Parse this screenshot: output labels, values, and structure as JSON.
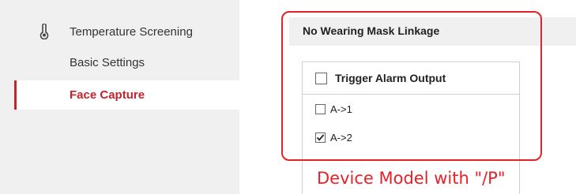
{
  "sidebar": {
    "section_label": "Temperature Screening",
    "section_icon": "thermometer-icon",
    "items": [
      {
        "label": "Basic Settings",
        "active": false
      },
      {
        "label": "Face Capture",
        "active": true
      }
    ],
    "accent_color": "#c4232b"
  },
  "panel": {
    "title": "No Wearing Mask Linkage",
    "table": {
      "header_label": "Trigger Alarm Output",
      "header_checked": false,
      "rows": [
        {
          "label": "A->1",
          "checked": false
        },
        {
          "label": "A->2",
          "checked": true
        }
      ]
    }
  },
  "annotation": {
    "caption": "Device Model with \"/P\"",
    "color": "#e62129"
  }
}
